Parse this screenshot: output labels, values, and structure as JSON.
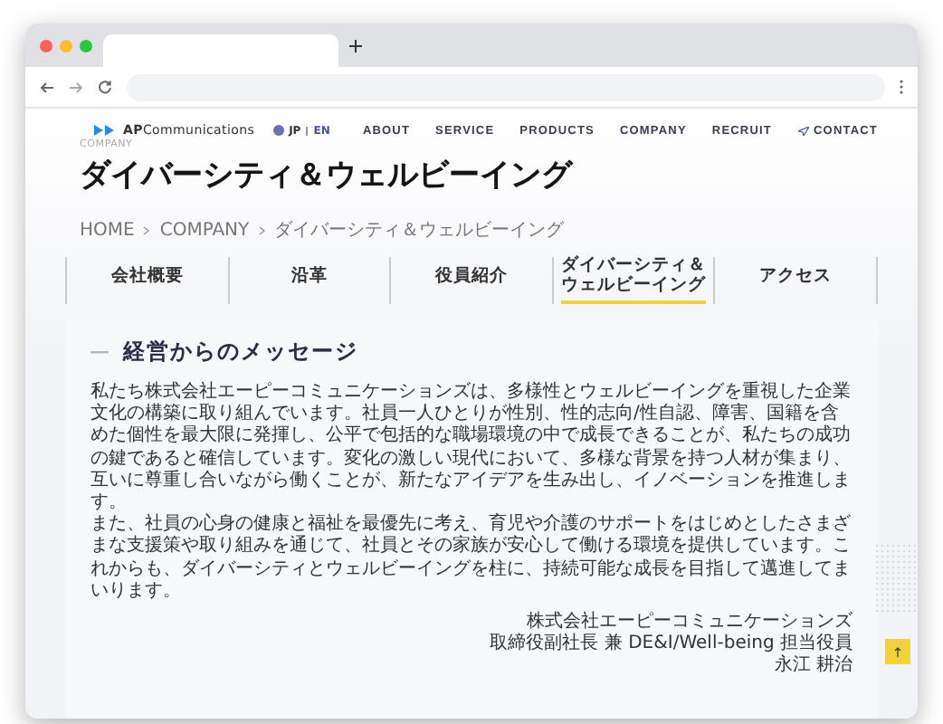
{
  "header": {
    "logo": "**AP**Communications",
    "languages": [
      {
        "label": "JP",
        "selected": true
      },
      {
        "label": "EN",
        "selected": false
      }
    ],
    "nav": [
      "ABOUT",
      "SERVICE",
      "PRODUCTS",
      "COMPANY",
      "RECRUIT"
    ],
    "contact": "CONTACT"
  },
  "section_label": "COMPANY",
  "title": "ダイバーシティ＆ウェルビーイング",
  "breadcrumb": [
    "HOME",
    "COMPANY",
    "ダイバーシティ＆ウェルビーイング"
  ],
  "tabs": [
    {
      "label": "会社概要",
      "selected": false
    },
    {
      "label": "沿革",
      "selected": false
    },
    {
      "label": "役員紹介",
      "selected": false
    },
    {
      "label": "ダイバーシティ＆ウェルビーイング",
      "selected": true
    },
    {
      "label": "アクセス",
      "selected": false
    }
  ],
  "message": {
    "heading": "経営からのメッセージ",
    "paragraphs": [
      "私たち株式会社エーピーコミュニケーションズは、多様性とウェルビーイングを重視した企業文化の構築に取り組んでいます。社員一人ひとりが性別、性的志向/性自認、障害、国籍を含めた個性を最大限に発揮し、公平で包括的な職場環境の中で成長できることが、私たちの成功の鍵であると確信しています。変化の激しい現代において、多様な背景を持つ人材が集まり、互いに尊重し合いながら働くことが、新たなアイデアを生み出し、イノベーションを推進します。",
      "また、社員の心身の健康と福祉を最優先に考え、育児や介護のサポートをはじめとしたさまざまな支援策や取り組みを通じて、社員とその家族が安心して働ける環境を提供しています。これからも、ダイバーシティとウェルビーイングを柱に、持続可能な成長を目指して邁進してまいります。"
    ],
    "signature": [
      "株式会社エーピーコミュニケーションズ",
      "取締役副社長 兼 DE&I/Well-being 担当役員",
      "永江 耕治"
    ]
  }
}
